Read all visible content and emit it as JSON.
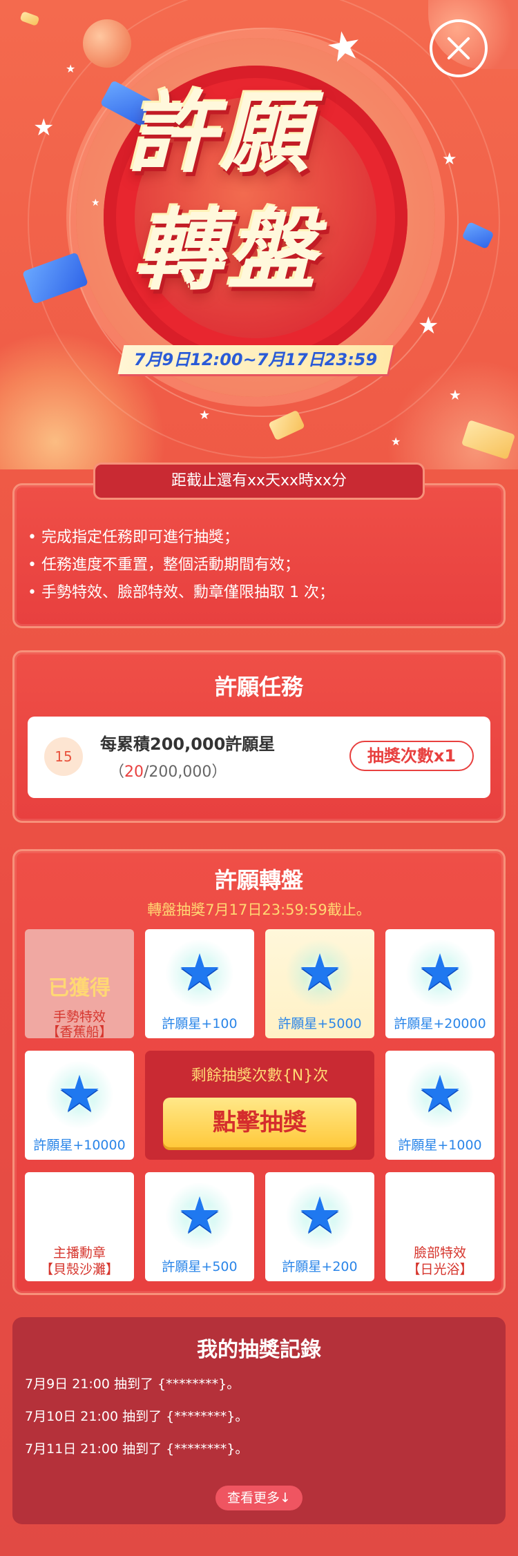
{
  "hero": {
    "title_line1": "許願",
    "title_line2": "轉盤",
    "date_range": "7月9日12:00~7月17日23:59",
    "close_icon": "close-icon"
  },
  "countdown": {
    "text": "距截止還有xx天xx時xx分"
  },
  "rules": [
    "• 完成指定任務即可進行抽獎；",
    "• 任務進度不重置，整個活動期間有效；",
    "• 手勢特效、臉部特效、勳章僅限抽取 1 次；"
  ],
  "task_section": {
    "title": "許願任務",
    "badge": "15",
    "name": "每累積200,000許願星",
    "progress_open": "（",
    "progress_current": "20",
    "progress_rest": "/200,000）",
    "reward": "抽獎次數x1"
  },
  "wheel_section": {
    "title": "許願轉盤",
    "note": "轉盤抽獎7月17日23:59:59截止。",
    "prizes": [
      {
        "label": "許願星+100"
      },
      {
        "label": "許願星+5000"
      },
      {
        "label": "許願星+20000"
      },
      {
        "label": "許願星+10000"
      },
      {
        "label": "許願星+1000"
      },
      {
        "label": "許願星+500"
      },
      {
        "label": "許願星+200"
      }
    ],
    "won_prize": {
      "status": "已獲得",
      "line1": "手勢特效",
      "line2": "【香蕉船】"
    },
    "badge_prize": {
      "line1": "主播勳章",
      "line2": "【貝殼沙灘】"
    },
    "face_prize": {
      "line1": "臉部特效",
      "line2": "【日光浴】"
    },
    "remaining": "剩餘抽獎次數{N}次",
    "draw_button": "點擊抽獎",
    "star_icon": "★"
  },
  "records": {
    "title": "我的抽獎記錄",
    "items": [
      "7月9日 21:00    抽到了 {********}。",
      "7月10日 21:00    抽到了 {********}。",
      "7月11日 21:00    抽到了 {********}。"
    ],
    "more_button": "查看更多↓"
  },
  "colors": {
    "background": "#ef5a46",
    "panel": "#e8403f",
    "accent_yellow": "#ffd873",
    "star_blue": "#1f78f0"
  }
}
